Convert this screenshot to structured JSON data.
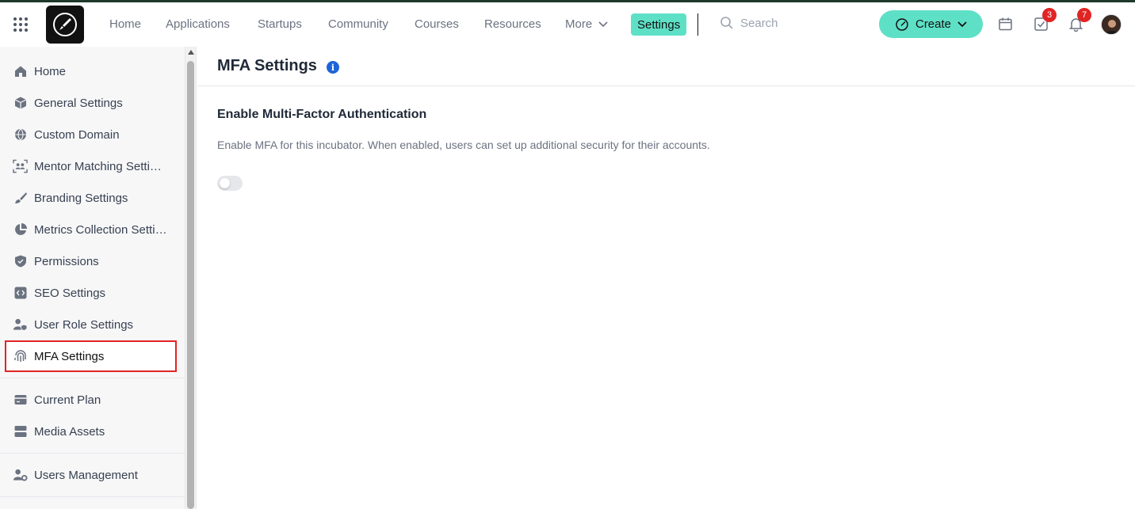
{
  "nav": {
    "links": [
      "Home",
      "Applications",
      "Startups",
      "Community",
      "Courses",
      "Resources"
    ],
    "more_label": "More",
    "settings_label": "Settings",
    "search_placeholder": "Search",
    "create_label": "Create",
    "tasks_badge": "3",
    "notifications_badge": "7"
  },
  "sidebar": {
    "items": [
      {
        "label": "Home",
        "icon": "home-icon"
      },
      {
        "label": "General Settings",
        "icon": "cube-icon"
      },
      {
        "label": "Custom Domain",
        "icon": "globe-icon"
      },
      {
        "label": "Mentor Matching Settings",
        "icon": "mentor-matching-icon"
      },
      {
        "label": "Branding Settings",
        "icon": "brush-icon"
      },
      {
        "label": "Metrics Collection Settings",
        "icon": "pie-chart-icon"
      },
      {
        "label": "Permissions",
        "icon": "shield-icon"
      },
      {
        "label": "SEO Settings",
        "icon": "code-icon"
      },
      {
        "label": "User Role Settings",
        "icon": "user-shield-icon"
      },
      {
        "label": "MFA Settings",
        "icon": "fingerprint-icon"
      }
    ],
    "secondary_items": [
      {
        "label": "Current Plan",
        "icon": "card-icon"
      },
      {
        "label": "Media Assets",
        "icon": "media-icon"
      }
    ],
    "tertiary_items": [
      {
        "label": "Users Management",
        "icon": "users-gear-icon"
      }
    ],
    "active_item": "MFA Settings"
  },
  "main": {
    "title": "MFA Settings",
    "info_icon": "i",
    "section_title": "Enable Multi-Factor Authentication",
    "section_description": "Enable MFA for this incubator. When enabled, users can set up additional security for their accounts.",
    "mfa_enabled": false
  },
  "colors": {
    "accent": "#5ee0c6",
    "badge": "#e02424",
    "info": "#1d64d8",
    "highlight_border": "#e02424"
  }
}
